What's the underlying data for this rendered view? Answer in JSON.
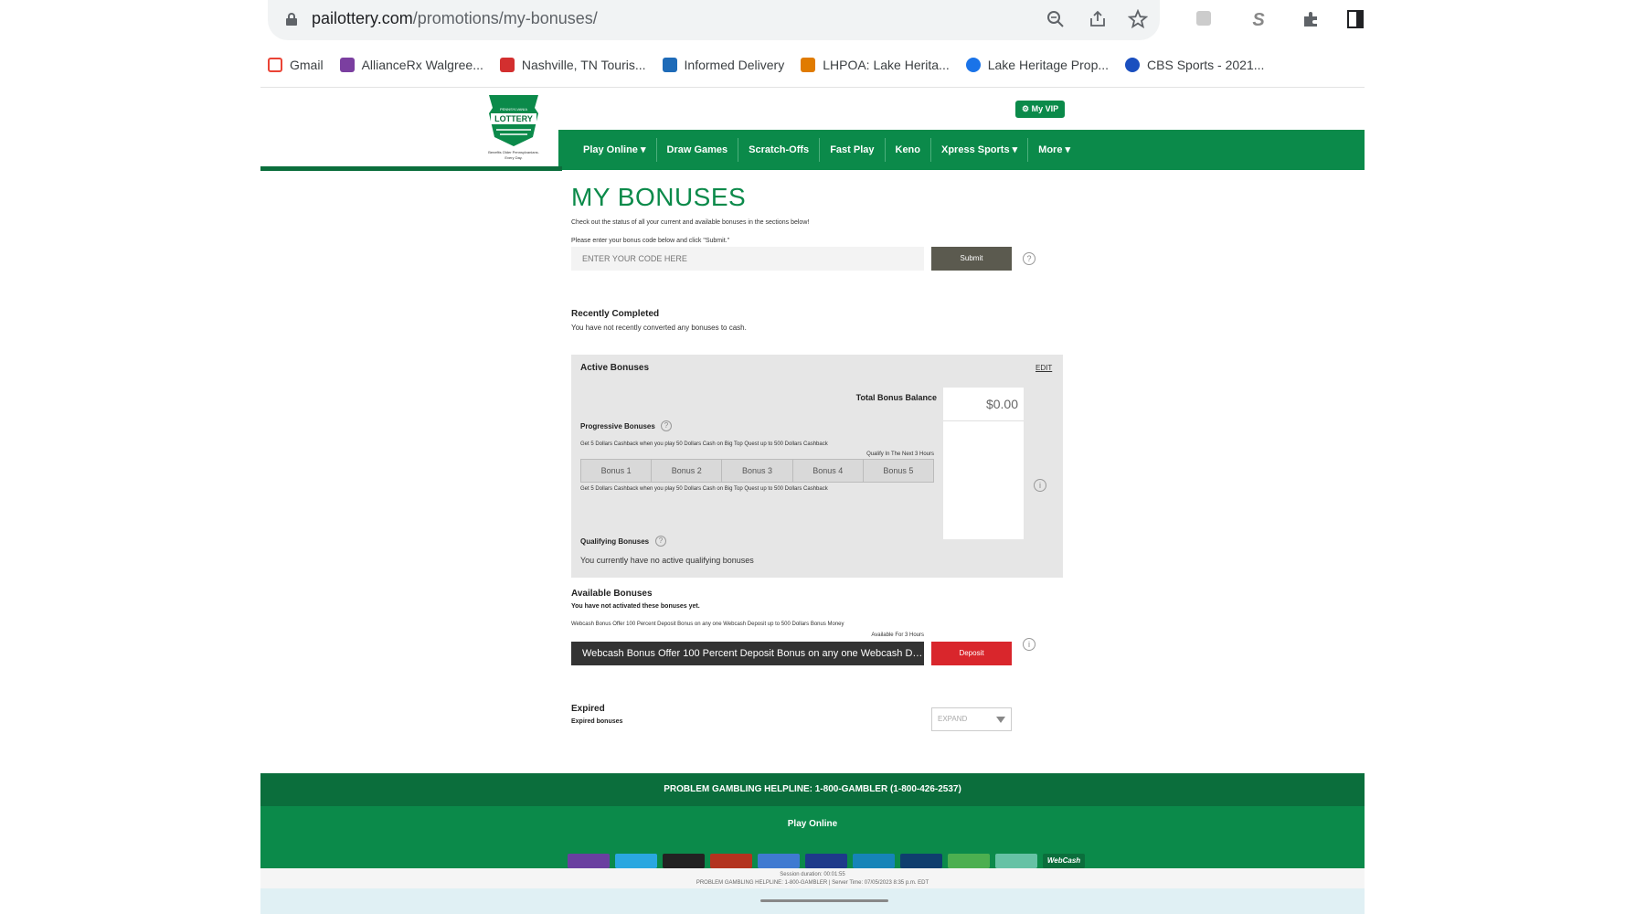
{
  "browser": {
    "url_domain": "pailottery.com",
    "url_path": "/promotions/my-bonuses/",
    "bookmarks": [
      {
        "label": "Gmail",
        "color": "#ea4335"
      },
      {
        "label": "AllianceRx Walgree...",
        "color": "#7b3fa0"
      },
      {
        "label": "Nashville, TN Touris...",
        "color": "#d32f2f"
      },
      {
        "label": "Informed Delivery",
        "color": "#1e6bb8"
      },
      {
        "label": "LHPOA: Lake Herita...",
        "color": "#e07b00"
      },
      {
        "label": "Lake Heritage Prop...",
        "color": "#1a73e8"
      },
      {
        "label": "CBS Sports - 2021...",
        "color": "#1a4fbf"
      }
    ]
  },
  "header": {
    "logo_text": "PENNSYLVANIA LOTTERY",
    "logo_tagline": "Benefits Older Pennsylvanians. Every Day.",
    "vip_label": "My VIP",
    "nav": [
      "Play Online ▾",
      "Draw Games",
      "Scratch-Offs",
      "Fast Play",
      "Keno",
      "Xpress Sports ▾",
      "More ▾"
    ]
  },
  "main": {
    "title": "MY BONUSES",
    "intro": "Check out the status of all your current and available bonuses in the sections below!",
    "code_prompt": "Please enter your bonus code below and click \"Submit.\"",
    "code_placeholder": "ENTER YOUR CODE HERE",
    "submit_label": "Submit",
    "recently_completed_title": "Recently Completed",
    "recently_completed_text": "You have not recently converted any bonuses to cash.",
    "active": {
      "title": "Active Bonuses",
      "edit_label": "EDIT",
      "total_label": "Total Bonus Balance",
      "total_value": "$0.00",
      "progressive_title": "Progressive Bonuses",
      "progressive_desc": "Get 5 Dollars Cashback when you play 50 Dollars Cash on Big Top Quest up to 500 Dollars Cashback",
      "progressive_qualify": "Qualify In The Next 3 Hours",
      "bonus_tabs": [
        "Bonus 1",
        "Bonus 2",
        "Bonus 3",
        "Bonus 4",
        "Bonus 5"
      ],
      "progressive_desc2": "Get 5 Dollars Cashback when you play 50 Dollars Cash on Big Top Quest up to 500 Dollars Cashback",
      "qualifying_title": "Qualifying Bonuses",
      "qualifying_text": "You currently have no active qualifying bonuses"
    },
    "available": {
      "title": "Available Bonuses",
      "subtitle": "You have not activated these bonuses yet.",
      "offer_desc": "Webcash Bonus Offer 100 Percent Deposit Bonus on any one Webcash Deposit up to 500 Dollars Bonus Money",
      "offer_avail": "Available For 3 Hours",
      "offer_bar": "Webcash Bonus Offer 100 Percent Deposit Bonus on any one Webcash Dep...",
      "deposit_label": "Deposit"
    },
    "expired": {
      "title": "Expired",
      "subtitle": "Expired bonuses",
      "expand_label": "EXPAND"
    }
  },
  "footer": {
    "helpline": "PROBLEM GAMBLING HELPLINE:  1-800-GAMBLER (1-800-426-2537)",
    "play_online": "Play Online",
    "webcash_label": "WebCash",
    "session": "Session duration: 00:01:55",
    "status_line": "PROBLEM GAMBLING HELPLINE: 1-800-GAMBLER | Server Time: 07/05/2023 8:35 p.m. EDT"
  },
  "colors": {
    "brand_green": "#0b8a4a",
    "dark_green": "#0b6e3c",
    "deposit_red": "#d9262c"
  }
}
